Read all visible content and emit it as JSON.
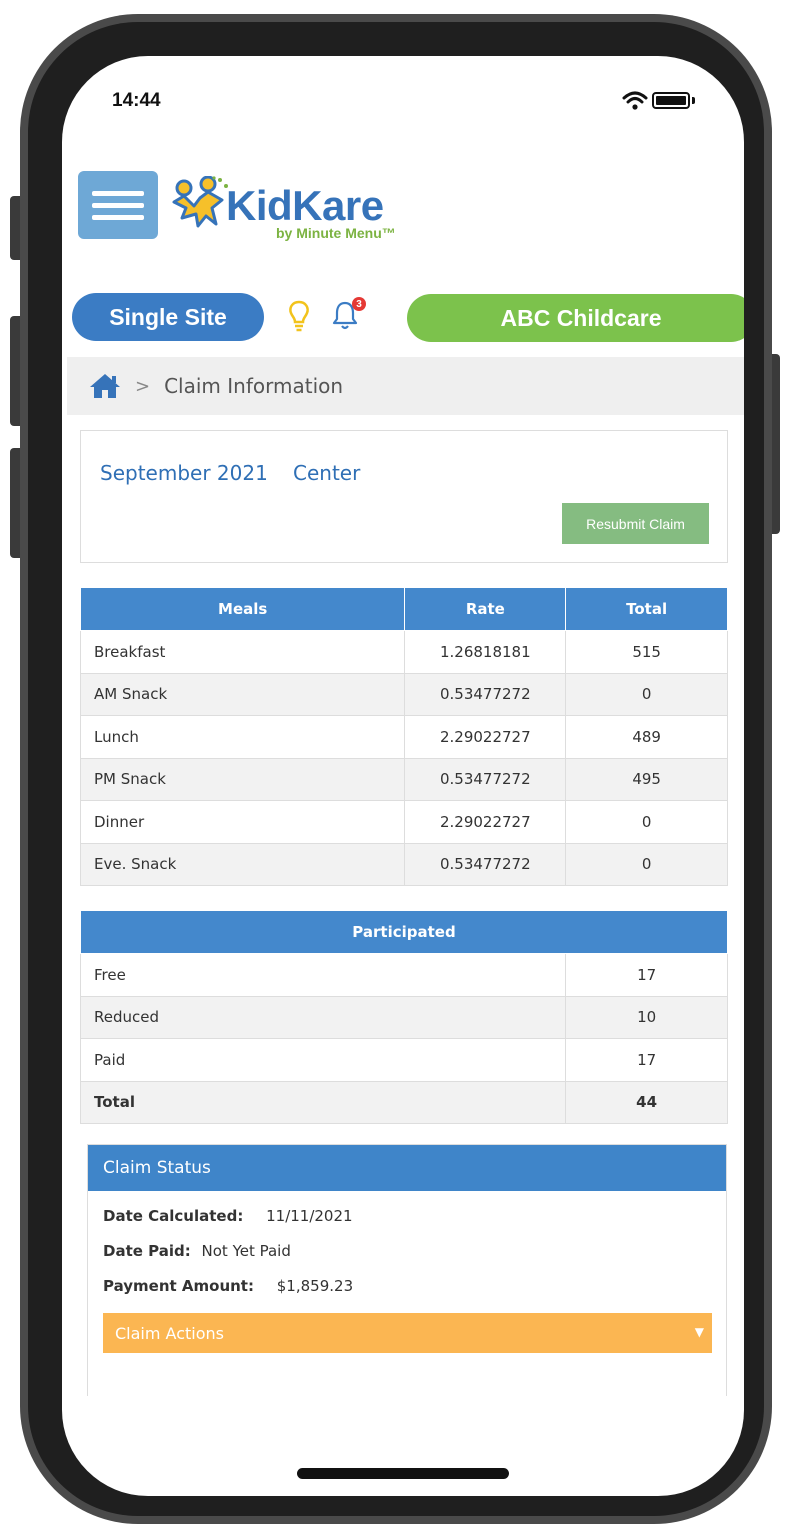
{
  "status_bar": {
    "time": "14:44",
    "wifi_icon": "wifi-icon",
    "battery_icon": "battery-icon"
  },
  "header": {
    "menu_icon": "hamburger-menu-icon",
    "logo": {
      "word": "KidKare",
      "sub": "by Minute Menu™"
    },
    "site_selector": "Single Site",
    "notification_count": "3",
    "center_selector": "ABC Childcare"
  },
  "breadcrumb": {
    "home_icon": "home-icon",
    "separator": ">",
    "current": "Claim Information"
  },
  "claim": {
    "month": "September 2021",
    "type": "Center",
    "resubmit_label": "Resubmit Claim"
  },
  "meals_table": {
    "headers": [
      "Meals",
      "Rate",
      "Total"
    ],
    "rows": [
      [
        "Breakfast",
        "1.26818181",
        "515"
      ],
      [
        "AM Snack",
        "0.53477272",
        "0"
      ],
      [
        "Lunch",
        "2.29022727",
        "489"
      ],
      [
        "PM Snack",
        "0.53477272",
        "495"
      ],
      [
        "Dinner",
        "2.29022727",
        "0"
      ],
      [
        "Eve. Snack",
        "0.53477272",
        "0"
      ]
    ]
  },
  "participation_table": {
    "header": "Participated",
    "rows": [
      [
        "Free",
        "17"
      ],
      [
        "Reduced",
        "10"
      ],
      [
        "Paid",
        "17"
      ]
    ],
    "total": [
      "Total",
      "44"
    ]
  },
  "claim_status": {
    "title": "Claim Status",
    "date_calculated_label": "Date Calculated:",
    "date_calculated": "11/11/2021",
    "date_paid_label": "Date Paid:",
    "date_paid": "Not Yet Paid",
    "payment_amount_label": "Payment Amount:",
    "payment_amount": "$1,859.23",
    "actions_label": "Claim Actions"
  },
  "colors": {
    "primary_blue": "#4488cc",
    "green_pill": "#7cc24c",
    "resubmit_green": "#85bc81",
    "actions_orange": "#fbb652"
  }
}
